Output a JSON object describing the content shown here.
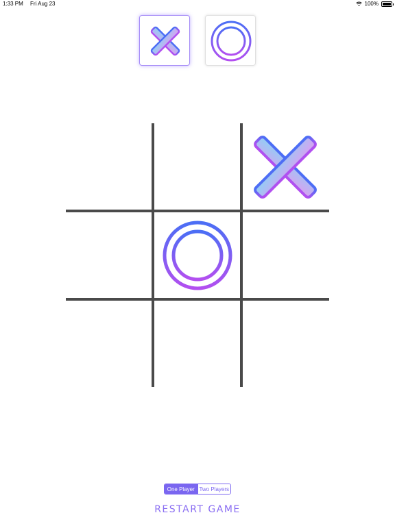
{
  "status_bar": {
    "time": "1:33 PM",
    "date": "Fri Aug 23",
    "battery": "100%",
    "icons": [
      "wifi-icon",
      "battery-icon"
    ]
  },
  "player_select": {
    "options": [
      "X",
      "O"
    ],
    "selected": "X"
  },
  "board": {
    "cells": [
      "",
      "",
      "X",
      "",
      "O",
      "",
      "",
      "",
      ""
    ]
  },
  "mode_switch": {
    "options": [
      "One Player",
      "Two Players"
    ],
    "selected": "One Player"
  },
  "restart_label": "RESTART GAME",
  "colors": {
    "accent": "#7a66f0",
    "gradient_blue": "#4b6ef5",
    "gradient_purple": "#b34ff0",
    "grid": "#4a4a4a"
  }
}
